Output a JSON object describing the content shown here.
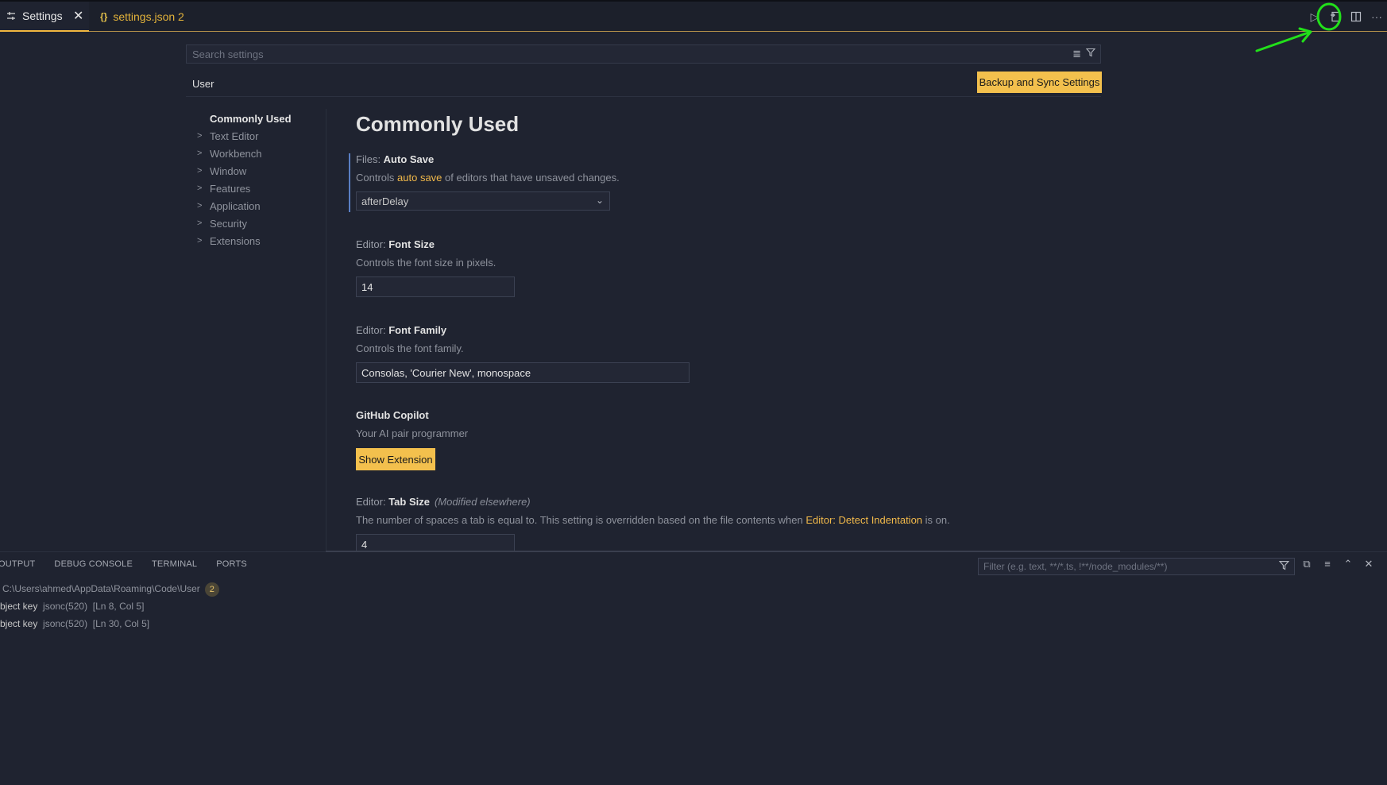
{
  "tabs": [
    {
      "label": "Settings",
      "icon": "settings-icon"
    },
    {
      "label": "settings.json 2",
      "icon": "json-braces-icon"
    }
  ],
  "search": {
    "placeholder": "Search settings"
  },
  "scope_tab": "User",
  "sync_button": "Backup and Sync Settings",
  "toc": {
    "active": "Commonly Used",
    "items": [
      "Text Editor",
      "Workbench",
      "Window",
      "Features",
      "Application",
      "Security",
      "Extensions"
    ]
  },
  "section_title": "Commonly Used",
  "settings": {
    "auto_save": {
      "category": "Files: ",
      "name": "Auto Save",
      "desc_pre": "Controls ",
      "desc_link": "auto save",
      "desc_post": " of editors that have unsaved changes.",
      "value": "afterDelay"
    },
    "font_size": {
      "category": "Editor: ",
      "name": "Font Size",
      "desc": "Controls the font size in pixels.",
      "value": "14"
    },
    "font_family": {
      "category": "Editor: ",
      "name": "Font Family",
      "desc": "Controls the font family.",
      "value": "Consolas, 'Courier New', monospace"
    },
    "copilot": {
      "name": "GitHub Copilot",
      "desc": "Your AI pair programmer",
      "button": "Show Extension"
    },
    "tab_size": {
      "category": "Editor: ",
      "name": "Tab Size",
      "modified": "(Modified elsewhere)",
      "desc_pre": "The number of spaces a tab is equal to. This setting is overridden based on the file contents when ",
      "desc_link": "Editor: Detect Indentation",
      "desc_post": " is on.",
      "value": "4"
    }
  },
  "panel": {
    "tabs": [
      "OUTPUT",
      "DEBUG CONSOLE",
      "TERMINAL",
      "PORTS"
    ],
    "filter_placeholder": "Filter (e.g. text, **/*.ts, !**/node_modules/**)",
    "path": "C:\\Users\\ahmed\\AppData\\Roaming\\Code\\User",
    "count": "2",
    "problems": [
      {
        "text": "bject key",
        "source": "jsonc(520)",
        "loc": "[Ln 8, Col 5]"
      },
      {
        "text": "bject key",
        "source": "jsonc(520)",
        "loc": "[Ln 30, Col 5]"
      }
    ]
  },
  "colors": {
    "accent": "#f3c04d",
    "background": "#1f2330",
    "annotation": "#22e01a"
  }
}
